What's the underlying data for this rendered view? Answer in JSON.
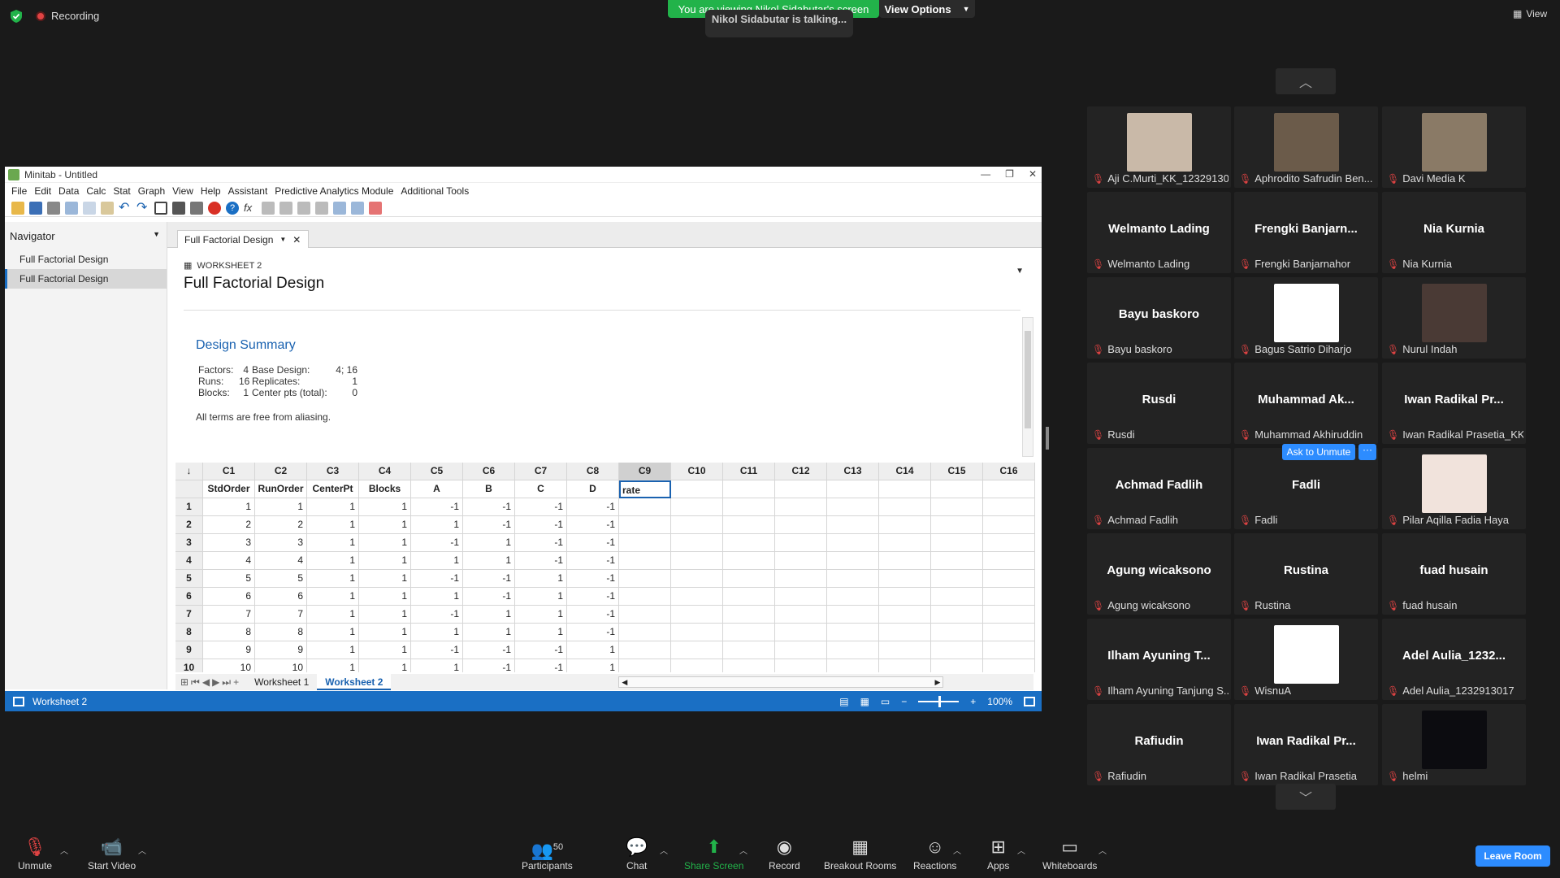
{
  "top": {
    "recording": "Recording",
    "banner": "You are viewing Nikol Sidabutar's screen",
    "view_options": "View Options",
    "talking": "Nikol Sidabutar is talking...",
    "view": "View"
  },
  "minitab": {
    "title": "Minitab - Untitled",
    "menu": [
      "File",
      "Edit",
      "Data",
      "Calc",
      "Stat",
      "Graph",
      "View",
      "Help",
      "Assistant",
      "Predictive Analytics Module",
      "Additional Tools"
    ],
    "navigator": {
      "title": "Navigator",
      "items": [
        "Full Factorial Design",
        "Full Factorial Design"
      ]
    },
    "doc_tab": "Full Factorial Design",
    "worksheet_label": "WORKSHEET 2",
    "report_title": "Full Factorial Design",
    "design_summary": {
      "heading": "Design Summary",
      "factors_label": "Factors:",
      "factors": "4",
      "base_label": "Base Design:",
      "base": "4; 16",
      "runs_label": "Runs:",
      "runs": "16",
      "rep_label": "Replicates:",
      "rep": "1",
      "blocks_label": "Blocks:",
      "blocks": "1",
      "center_label": "Center pts (total):",
      "center": "0"
    },
    "aliasing": "All terms are free from aliasing.",
    "grid": {
      "corner": "↓",
      "columns": [
        "C1",
        "C2",
        "C3",
        "C4",
        "C5",
        "C6",
        "C7",
        "C8",
        "C9",
        "C10",
        "C11",
        "C12",
        "C13",
        "C14",
        "C15",
        "C16"
      ],
      "names": [
        "StdOrder",
        "RunOrder",
        "CenterPt",
        "Blocks",
        "A",
        "B",
        "C",
        "D",
        "rate",
        "",
        "",
        "",
        "",
        "",
        "",
        ""
      ],
      "rows": [
        [
          "1",
          "1",
          "1",
          "1",
          "1",
          "-1",
          "-1",
          "-1",
          "-1"
        ],
        [
          "2",
          "2",
          "2",
          "1",
          "1",
          "1",
          "-1",
          "-1",
          "-1"
        ],
        [
          "3",
          "3",
          "3",
          "1",
          "1",
          "-1",
          "1",
          "-1",
          "-1"
        ],
        [
          "4",
          "4",
          "4",
          "1",
          "1",
          "1",
          "1",
          "-1",
          "-1"
        ],
        [
          "5",
          "5",
          "5",
          "1",
          "1",
          "-1",
          "-1",
          "1",
          "-1"
        ],
        [
          "6",
          "6",
          "6",
          "1",
          "1",
          "1",
          "-1",
          "1",
          "-1"
        ],
        [
          "7",
          "7",
          "7",
          "1",
          "1",
          "-1",
          "1",
          "1",
          "-1"
        ],
        [
          "8",
          "8",
          "8",
          "1",
          "1",
          "1",
          "1",
          "1",
          "-1"
        ],
        [
          "9",
          "9",
          "9",
          "1",
          "1",
          "-1",
          "-1",
          "-1",
          "1"
        ],
        [
          "10",
          "10",
          "10",
          "1",
          "1",
          "1",
          "-1",
          "-1",
          "1"
        ]
      ]
    },
    "sheets": [
      "Worksheet 1",
      "Worksheet 2"
    ],
    "status": {
      "sheet": "Worksheet 2",
      "zoom": "100%",
      "zoom_level_pct": 100
    }
  },
  "gallery": {
    "participants": [
      {
        "name": "",
        "label": "Aji C.Murti_KK_12329130...",
        "photo": true
      },
      {
        "name": "",
        "label": "Aphrodito Safrudin Ben...",
        "photo": true
      },
      {
        "name": "",
        "label": "Davi Media K",
        "photo": true
      },
      {
        "name": "Welmanto Lading",
        "label": "Welmanto Lading",
        "photo": false
      },
      {
        "name": "Frengki  Banjarn...",
        "label": "Frengki Banjarnahor",
        "photo": false
      },
      {
        "name": "Nia Kurnia",
        "label": "Nia Kurnia",
        "photo": false
      },
      {
        "name": "Bayu baskoro",
        "label": "Bayu baskoro",
        "photo": false
      },
      {
        "name": "",
        "label": "Bagus Satrio Diharjo",
        "photo": true
      },
      {
        "name": "",
        "label": "Nurul Indah",
        "photo": true
      },
      {
        "name": "Rusdi",
        "label": "Rusdi",
        "photo": false
      },
      {
        "name": "Muhammad  Ak...",
        "label": "Muhammad Akhiruddin",
        "photo": false
      },
      {
        "name": "Iwan Radikal  Pr...",
        "label": "Iwan Radikal Prasetia_KK",
        "photo": false
      },
      {
        "name": "Achmad Fadlih",
        "label": "Achmad Fadlih",
        "photo": false
      },
      {
        "name": "Fadli",
        "label": "Fadli",
        "photo": false
      },
      {
        "name": "",
        "label": "Pilar Aqilla Fadia Haya",
        "photo": true
      },
      {
        "name": "Agung wicaksono",
        "label": "Agung wicaksono",
        "photo": false
      },
      {
        "name": "Rustina",
        "label": "Rustina",
        "photo": false
      },
      {
        "name": "fuad husain",
        "label": "fuad husain",
        "photo": false
      },
      {
        "name": "Ilham Ayuning  T...",
        "label": "Ilham Ayuning Tanjung S...",
        "photo": false
      },
      {
        "name": "",
        "label": "WisnuA",
        "photo": true
      },
      {
        "name": "Adel  Aulia_1232...",
        "label": "Adel Aulia_1232913017",
        "photo": false
      },
      {
        "name": "Rafiudin",
        "label": "Rafiudin",
        "photo": false
      },
      {
        "name": "Iwan  Radikal  Pr...",
        "label": "Iwan Radikal Prasetia",
        "photo": false
      },
      {
        "name": "",
        "label": "helmi",
        "photo": true
      }
    ],
    "ask_to_unmute": "Ask to Unmute",
    "more": "···"
  },
  "toolbar": {
    "unmute": "Unmute",
    "start_video": "Start Video",
    "participants": "Participants",
    "participants_count": "50",
    "chat": "Chat",
    "share_screen": "Share Screen",
    "record": "Record",
    "breakout": "Breakout Rooms",
    "reactions": "Reactions",
    "apps": "Apps",
    "whiteboards": "Whiteboards",
    "leave": "Leave Room"
  },
  "colors": {
    "zoom_blue": "#2d8cff",
    "share_green": "#22b34a",
    "minitab_blue": "#1a6fc4",
    "mute_red": "#e04343"
  }
}
